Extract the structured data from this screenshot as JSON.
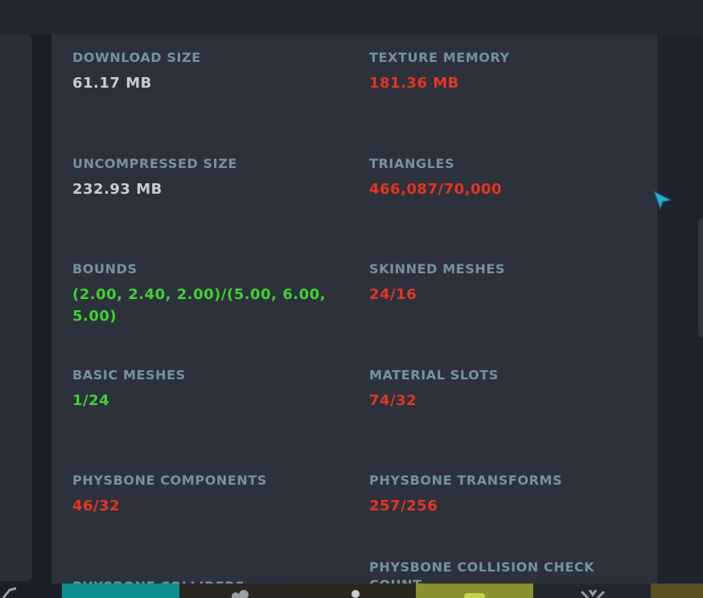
{
  "stats": [
    {
      "label": "DOWNLOAD SIZE",
      "value": "61.17 MB",
      "status": "neutral"
    },
    {
      "label": "TEXTURE MEMORY",
      "value": "181.36 MB",
      "status": "bad"
    },
    {
      "label": "UNCOMPRESSED SIZE",
      "value": "232.93 MB",
      "status": "neutral"
    },
    {
      "label": "TRIANGLES",
      "value": "466,087/70,000",
      "status": "bad"
    },
    {
      "label": "BOUNDS",
      "value": "(2.00, 2.40, 2.00)/(5.00, 6.00, 5.00)",
      "status": "good"
    },
    {
      "label": "SKINNED MESHES",
      "value": "24/16",
      "status": "bad"
    },
    {
      "label": "BASIC MESHES",
      "value": "1/24",
      "status": "good"
    },
    {
      "label": "MATERIAL SLOTS",
      "value": "74/32",
      "status": "bad"
    },
    {
      "label": "PHYSBONE COMPONENTS",
      "value": "46/32",
      "status": "bad"
    },
    {
      "label": "PHYSBONE TRANSFORMS",
      "value": "257/256",
      "status": "bad"
    },
    {
      "label": "PHYSBONE COLLIDERS",
      "value": "",
      "status": "bad"
    },
    {
      "label": "PHYSBONE COLLISION CHECK COUNT",
      "value": "",
      "status": "bad"
    }
  ],
  "colors": {
    "label": "#74939c",
    "neutral": "#c9ccd1",
    "bad": "#e4361f",
    "good": "#3fd22f",
    "cursor": "#29a9d6"
  },
  "icons": {
    "cursor": "pointer-cursor-icon",
    "taskbar": [
      "launch-icon",
      "social-icon",
      "profile-icon",
      "avatar-icon",
      "world-icon"
    ]
  }
}
